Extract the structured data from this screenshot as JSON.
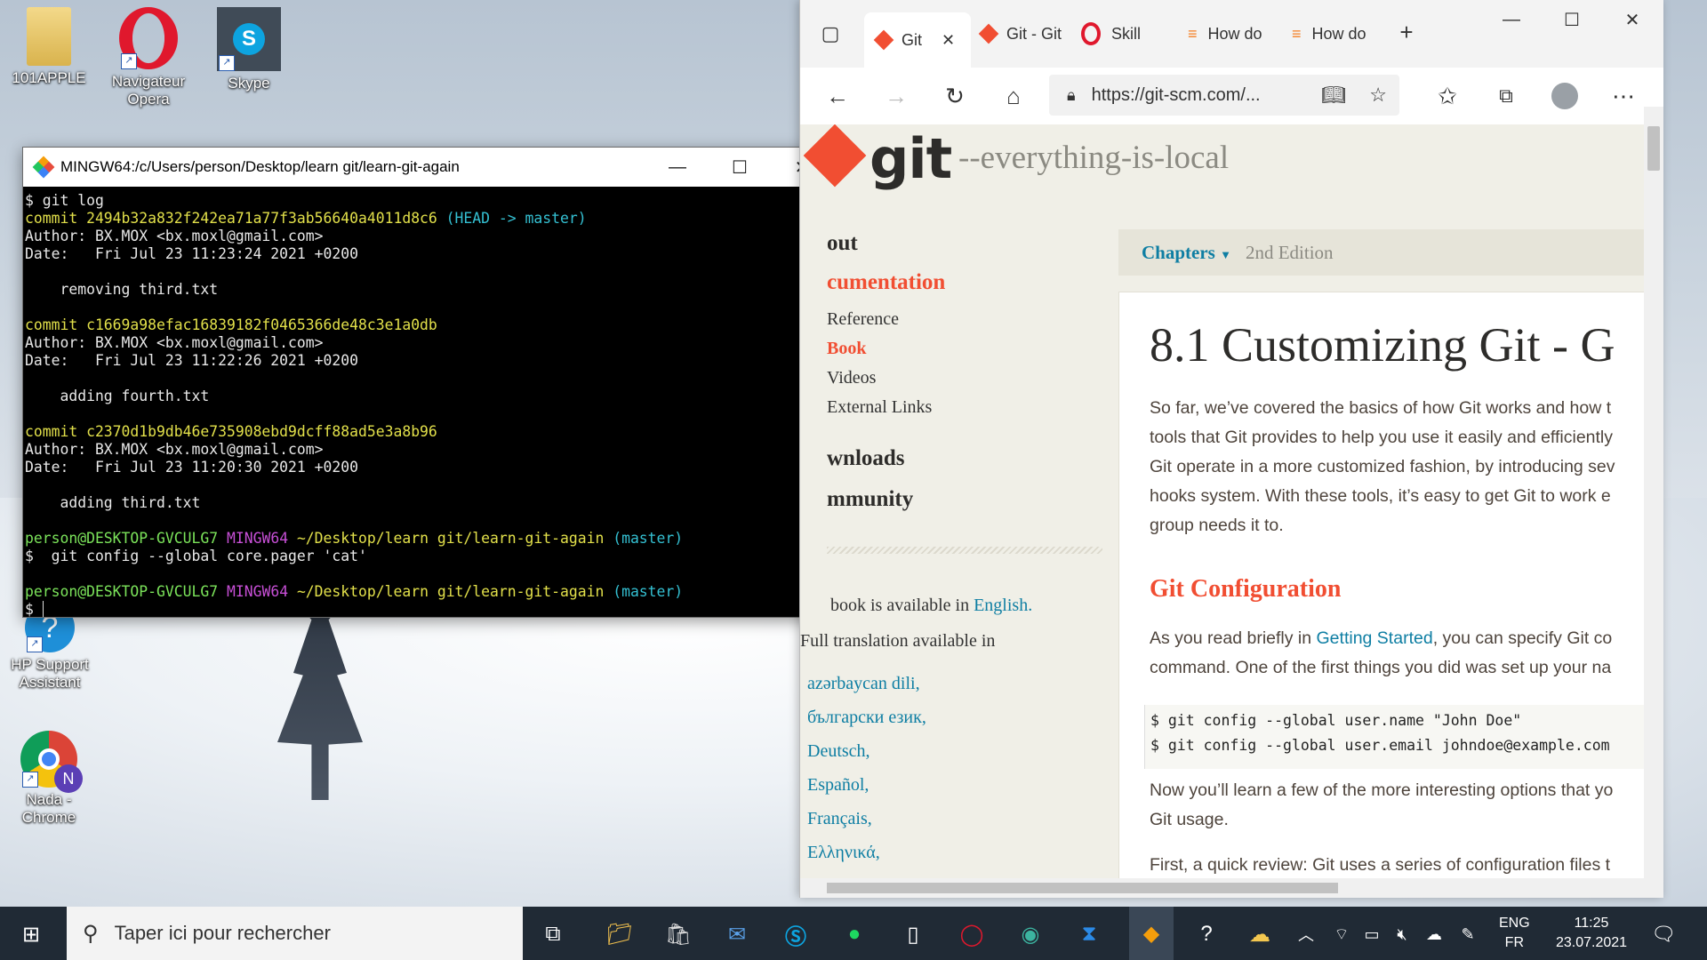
{
  "desktop": {
    "icons": [
      {
        "label": "101APPLE"
      },
      {
        "label": "Navigateur Opera"
      },
      {
        "label": "Skype"
      },
      {
        "label": "HP Support Assistant"
      },
      {
        "label": "Nada - Chrome"
      }
    ]
  },
  "terminal": {
    "title": "MINGW64:/c/Users/person/Desktop/learn git/learn-git-again",
    "lines": {
      "l1": "$ git log",
      "c1_hash": "commit 2494b32a832f242ea71a77f3ab56640a4011d8c6",
      "c1_ref": "(HEAD -> master)",
      "c1_author": "Author: BX.MOX <bx.moxl@gmail.com>",
      "c1_date": "Date:   Fri Jul 23 11:23:24 2021 +0200",
      "c1_msg": "    removing third.txt",
      "c2_hash": "commit c1669a98efac16839182f0465366de48c3e1a0db",
      "c2_author": "Author: BX.MOX <bx.moxl@gmail.com>",
      "c2_date": "Date:   Fri Jul 23 11:22:26 2021 +0200",
      "c2_msg": "    adding fourth.txt",
      "c3_hash": "commit c2370d1b9db46e735908ebd9dcff88ad5e3a8b96",
      "c3_author": "Author: BX.MOX <bx.moxl@gmail.com>",
      "c3_date": "Date:   Fri Jul 23 11:20:30 2021 +0200",
      "c3_msg": "    adding third.txt",
      "p1_user": "person@DESKTOP-GVCULG7",
      "p1_sys": "MINGW64",
      "p1_path": "~/Desktop/learn git/learn-git-again",
      "p1_branch": "(master)",
      "cmd2": "$  git config --global core.pager 'cat'",
      "p2_user": "person@DESKTOP-GVCULG7",
      "p2_sys": "MINGW64",
      "p2_path": "~/Desktop/learn git/learn-git-again",
      "p2_branch": "(master)",
      "prompt": "$ "
    }
  },
  "browser": {
    "tabs": [
      {
        "label": "Git",
        "active": true
      },
      {
        "label": "Git - Git"
      },
      {
        "label": "Skill"
      },
      {
        "label": "How do"
      },
      {
        "label": "How do"
      }
    ],
    "address": "https://git-scm.com/...",
    "site": {
      "logo": "git",
      "tagline": "--everything-is-local",
      "nav": {
        "about": "out",
        "documentation": "cumentation",
        "reference": "Reference",
        "book": "Book",
        "videos": "Videos",
        "external": "External Links",
        "downloads": "wnloads",
        "community": "mmunity"
      },
      "availability": "book is available in",
      "english": "English.",
      "full_translation": "Full translation available in",
      "languages": [
        "azərbaycan dili,",
        "български език,",
        "Deutsch,",
        "Español,",
        "Français,",
        "Ελληνικά,"
      ],
      "chapters": "Chapters",
      "edition": "2nd Edition",
      "heading": "8.1 Customizing Git - G",
      "intro": [
        "So far, we’ve covered the basics of how Git works and how t",
        "tools that Git provides to help you use it easily and efficiently",
        "Git operate in a more customized fashion, by introducing sev",
        "hooks system. With these tools, it’s easy to get Git to work e",
        "group needs it to."
      ],
      "section": "Git Configuration",
      "config_p1_pre": "As you read briefly in ",
      "config_p1_link": "Getting Started",
      "config_p1_post": ", you can specify Git co",
      "config_p2": "command. One of the first things you did was set up your na",
      "code_lines": [
        "$ git config --global user.name \"John Doe\"",
        "$ git config --global user.email johndoe@example.com"
      ],
      "learn_p": [
        "Now you’ll learn a few of the more interesting options that yo",
        "Git usage."
      ],
      "first_p": "First, a quick review: Git uses a series of configuration files t"
    }
  },
  "taskbar": {
    "search_placeholder": "Taper ici pour rechercher",
    "lang_top": "ENG",
    "lang_bottom": "FR",
    "time": "11:25",
    "date": "23.07.2021"
  }
}
